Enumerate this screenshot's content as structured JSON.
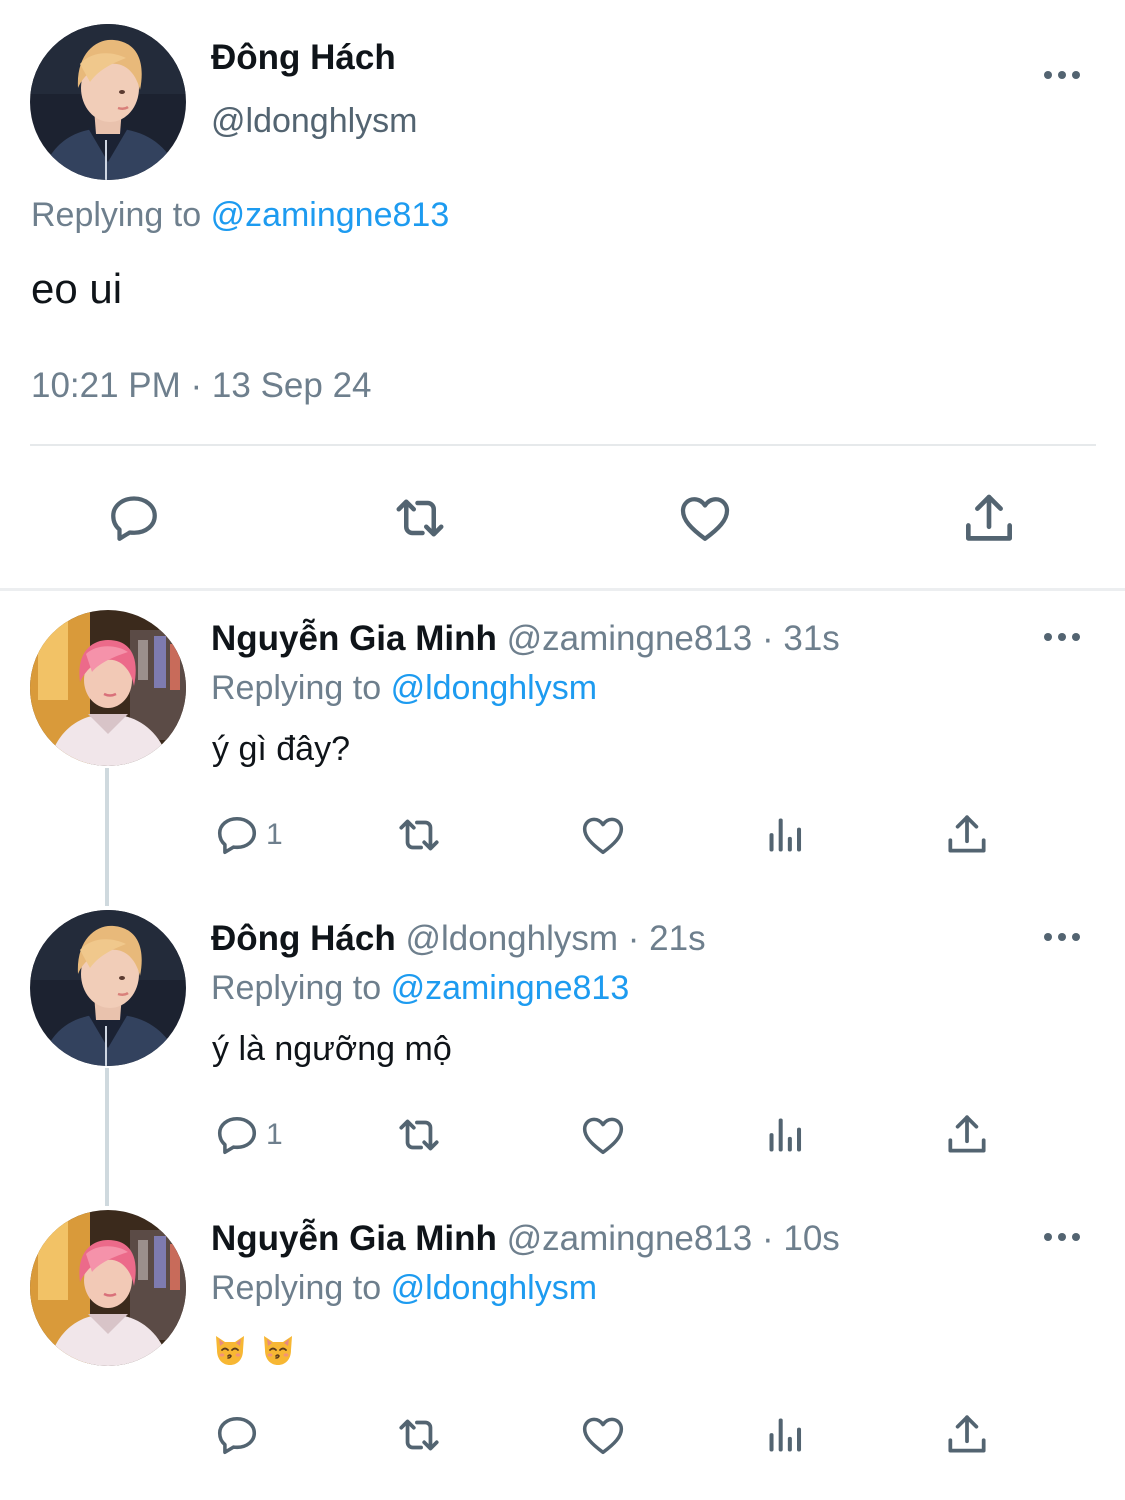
{
  "main_tweet": {
    "author_name": "Đông Hách",
    "author_handle": "@ldonghlysm",
    "replying_prefix": "Replying to",
    "replying_to": "@zamingne813",
    "text": "eo ui",
    "timestamp": "10:21 PM · 13 Sep 24",
    "actions": [
      "reply-icon",
      "retweet-icon",
      "like-icon",
      "share-icon"
    ]
  },
  "replies": [
    {
      "author_name": "Nguyễn Gia Minh",
      "author_meta": "@zamingne813 · 31s",
      "replying_prefix": "Replying to",
      "replying_to": "@ldonghlysm",
      "text": "ý gì đây?",
      "reply_count": "1"
    },
    {
      "author_name": "Đông Hách",
      "author_meta": "@ldonghlysm · 21s",
      "replying_prefix": "Replying to",
      "replying_to": "@zamingne813",
      "text": "ý là ngưỡng mộ",
      "reply_count": "1"
    },
    {
      "author_name": "Nguyễn Gia Minh",
      "author_meta": "@zamingne813 · 10s",
      "replying_prefix": "Replying to",
      "replying_to": "@ldonghlysm",
      "text": "😽😽",
      "emoji_icons": [
        "kissing-cat-emoji-icon",
        "kissing-cat-emoji-icon"
      ],
      "reply_count": ""
    }
  ],
  "colors": {
    "text_primary": "#0f1419",
    "text_secondary": "#6e7f8d",
    "mention": "#1d9bf0",
    "icon": "#536471",
    "divider": "#e6e9eb",
    "thread_line": "#cfd9de"
  }
}
